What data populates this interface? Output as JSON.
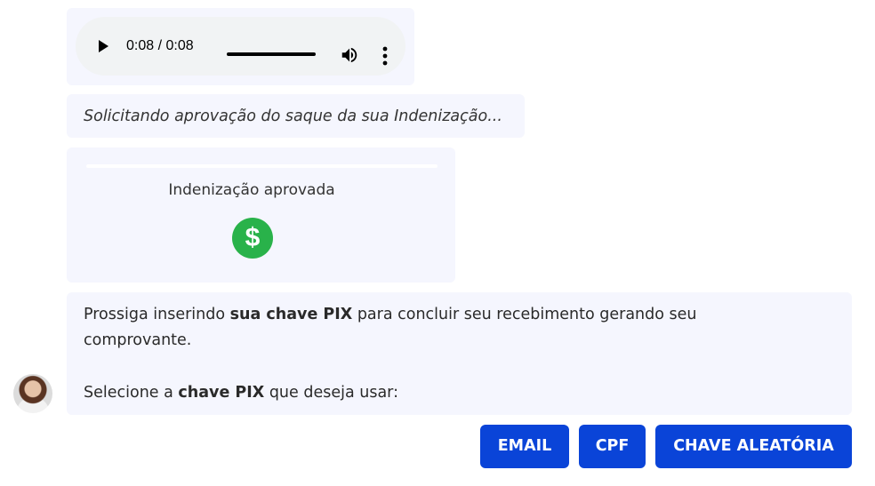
{
  "audio": {
    "current_time": "0:08",
    "separator": " / ",
    "duration": "0:08",
    "progress": 1.0
  },
  "status_message": "Solicitando aprovação do saque da sua Indenização...",
  "approval_card": {
    "title": "Indenização aprovada",
    "icon_symbol": "$",
    "icon": "dollar-circle-icon",
    "icon_color": "#29b24a"
  },
  "message": {
    "line1_pre": "Prossiga inserindo ",
    "line1_bold": "sua chave PIX",
    "line1_post": " para concluir seu recebimento gerando seu comprovante.",
    "line2_pre": "Selecione a ",
    "line2_bold": "chave PIX",
    "line2_post": " que deseja usar:"
  },
  "buttons": {
    "email": "EMAIL",
    "cpf": "CPF",
    "chave_aleatoria": "CHAVE ALEATÓRIA"
  },
  "colors": {
    "accent": "#0a44d8",
    "bubble_bg": "#f5f6fe",
    "success": "#29b24a"
  }
}
